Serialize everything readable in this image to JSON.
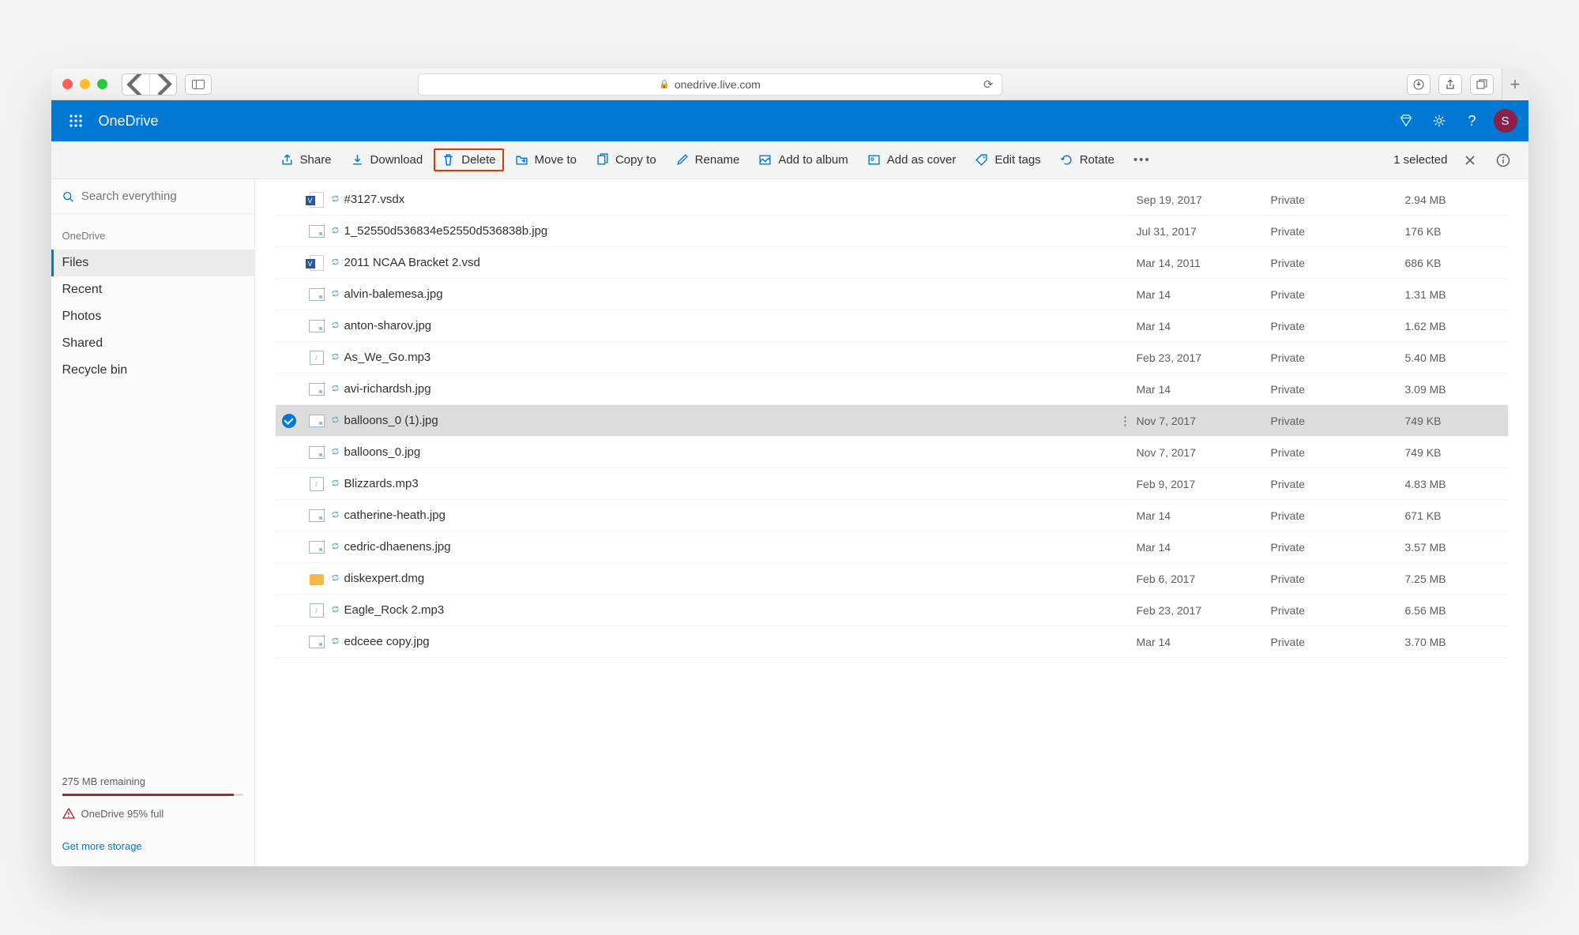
{
  "browser": {
    "url": "onedrive.live.com"
  },
  "header": {
    "app": "OneDrive",
    "avatar": "S"
  },
  "toolbar": {
    "share": "Share",
    "download": "Download",
    "delete": "Delete",
    "move": "Move to",
    "copy": "Copy to",
    "rename": "Rename",
    "album": "Add to album",
    "cover": "Add as cover",
    "tags": "Edit tags",
    "rotate": "Rotate",
    "selected": "1 selected"
  },
  "sidebar": {
    "search_placeholder": "Search everything",
    "section": "OneDrive",
    "items": [
      "Files",
      "Recent",
      "Photos",
      "Shared",
      "Recycle bin"
    ],
    "storage_remaining": "275 MB remaining",
    "storage_full": "OneDrive 95% full",
    "get_more": "Get more storage"
  },
  "files": [
    {
      "icon": "visio",
      "name": "#3127.vsdx",
      "date": "Sep 19, 2017",
      "share": "Private",
      "size": "2.94 MB",
      "sel": false
    },
    {
      "icon": "img",
      "name": "1_52550d536834e52550d536838b.jpg",
      "date": "Jul 31, 2017",
      "share": "Private",
      "size": "176 KB",
      "sel": false
    },
    {
      "icon": "visio",
      "name": "2011 NCAA Bracket 2.vsd",
      "date": "Mar 14, 2011",
      "share": "Private",
      "size": "686 KB",
      "sel": false
    },
    {
      "icon": "img",
      "name": "alvin-balemesa.jpg",
      "date": "Mar 14",
      "share": "Private",
      "size": "1.31 MB",
      "sel": false
    },
    {
      "icon": "img",
      "name": "anton-sharov.jpg",
      "date": "Mar 14",
      "share": "Private",
      "size": "1.62 MB",
      "sel": false
    },
    {
      "icon": "audio",
      "name": "As_We_Go.mp3",
      "date": "Feb 23, 2017",
      "share": "Private",
      "size": "5.40 MB",
      "sel": false
    },
    {
      "icon": "img",
      "name": "avi-richardsh.jpg",
      "date": "Mar 14",
      "share": "Private",
      "size": "3.09 MB",
      "sel": false
    },
    {
      "icon": "img",
      "name": "balloons_0 (1).jpg",
      "date": "Nov 7, 2017",
      "share": "Private",
      "size": "749 KB",
      "sel": true
    },
    {
      "icon": "img",
      "name": "balloons_0.jpg",
      "date": "Nov 7, 2017",
      "share": "Private",
      "size": "749 KB",
      "sel": false
    },
    {
      "icon": "audio",
      "name": "Blizzards.mp3",
      "date": "Feb 9, 2017",
      "share": "Private",
      "size": "4.83 MB",
      "sel": false
    },
    {
      "icon": "img",
      "name": "catherine-heath.jpg",
      "date": "Mar 14",
      "share": "Private",
      "size": "671 KB",
      "sel": false
    },
    {
      "icon": "img",
      "name": "cedric-dhaenens.jpg",
      "date": "Mar 14",
      "share": "Private",
      "size": "3.57 MB",
      "sel": false
    },
    {
      "icon": "pkg",
      "name": "diskexpert.dmg",
      "date": "Feb 6, 2017",
      "share": "Private",
      "size": "7.25 MB",
      "sel": false
    },
    {
      "icon": "audio",
      "name": "Eagle_Rock 2.mp3",
      "date": "Feb 23, 2017",
      "share": "Private",
      "size": "6.56 MB",
      "sel": false
    },
    {
      "icon": "img",
      "name": "edceee copy.jpg",
      "date": "Mar 14",
      "share": "Private",
      "size": "3.70 MB",
      "sel": false
    }
  ]
}
